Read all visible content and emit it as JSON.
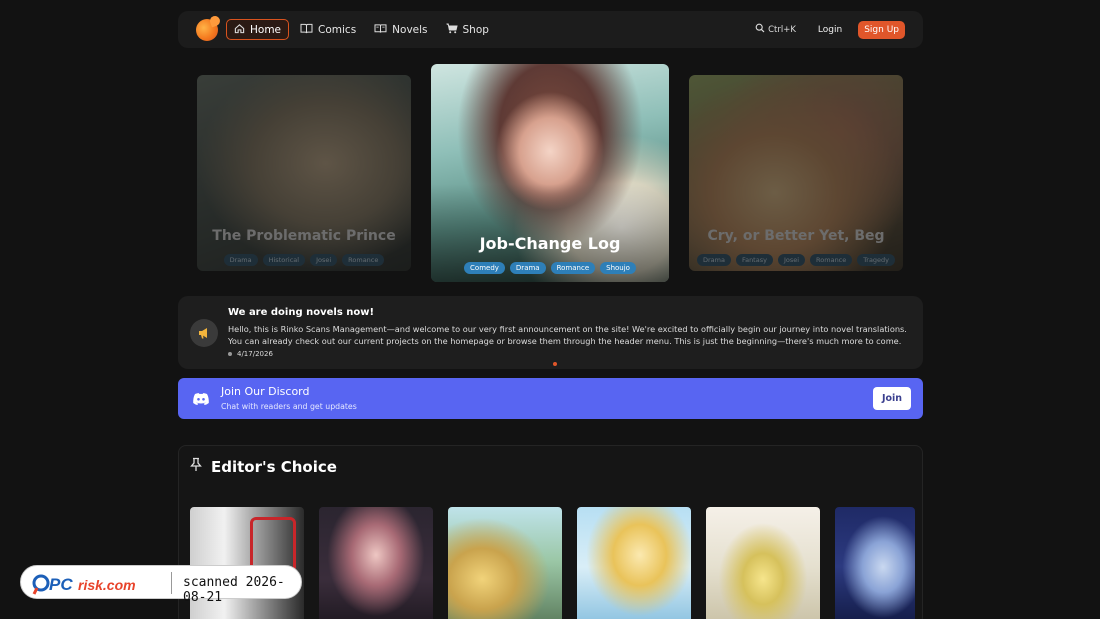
{
  "header": {
    "nav": [
      {
        "label": "Home",
        "icon": "home-icon",
        "active": true
      },
      {
        "label": "Comics",
        "icon": "book-open-icon",
        "active": false
      },
      {
        "label": "Novels",
        "icon": "book-icon",
        "active": false
      },
      {
        "label": "Shop",
        "icon": "cart-icon",
        "active": false
      }
    ],
    "search_shortcut": "Ctrl+K",
    "login": "Login",
    "signup": "Sign Up",
    "accent": "#e0562a"
  },
  "carousel": {
    "left": {
      "title": "The Problematic Prince",
      "tags": [
        "Drama",
        "Historical",
        "Josei",
        "Romance"
      ]
    },
    "center": {
      "title": "Job-Change Log",
      "tags": [
        "Comedy",
        "Drama",
        "Romance",
        "Shoujo"
      ]
    },
    "right": {
      "title": "Cry, or Better Yet, Beg",
      "tags": [
        "Drama",
        "Fantasy",
        "Josei",
        "Romance",
        "Tragedy"
      ]
    }
  },
  "announcement": {
    "title": "We are doing novels now!",
    "body": "Hello, this is Rinko Scans Management—and welcome to our very first announcement on the site! We're excited to officially begin our journey into novel translations. You can already check out our current projects on the homepage or browse them through the header menu. This is just the beginning—there's much more to come. We hop",
    "date": "4/17/2026"
  },
  "discord": {
    "title": "Join Our Discord",
    "subtitle": "Chat with readers and get updates",
    "button": "Join",
    "color": "#5865f2"
  },
  "editors_choice": {
    "title": "Editor's Choice"
  },
  "watermark": {
    "brand_pc": "PC",
    "brand_risk": "risk.com",
    "scan_text": "scanned 2026-08-21"
  }
}
